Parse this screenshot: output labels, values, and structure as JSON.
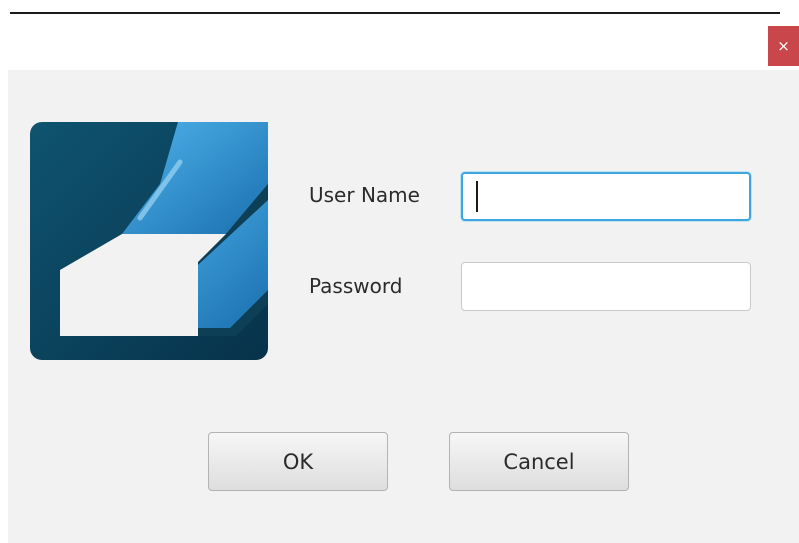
{
  "window": {
    "close_glyph": "×",
    "close_color": "#c9464a"
  },
  "form": {
    "username_label": "User Name",
    "username_value": "",
    "password_label": "Password",
    "password_value": ""
  },
  "buttons": {
    "ok_label": "OK",
    "cancel_label": "Cancel"
  },
  "icons": {
    "logo": "company-logo-icon",
    "close": "close-icon"
  },
  "colors": {
    "focus_border": "#3ea6de",
    "logo_dark": "#0d3f57",
    "logo_blue": "#2a8bc9"
  }
}
